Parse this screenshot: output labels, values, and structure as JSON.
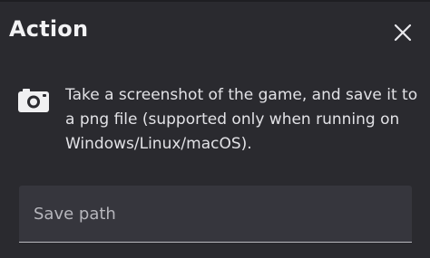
{
  "dialog": {
    "title": "Action",
    "close_icon": "close-icon"
  },
  "action": {
    "icon": "camera-icon",
    "description": "Take a screenshot of the game, and save it to a png file (supported only when running on Windows/Linux/macOS)."
  },
  "save_path": {
    "placeholder": "Save path",
    "value": ""
  },
  "colors": {
    "background": "#2a2a2f",
    "field_background": "#36363d",
    "text": "#e6e6e8"
  }
}
